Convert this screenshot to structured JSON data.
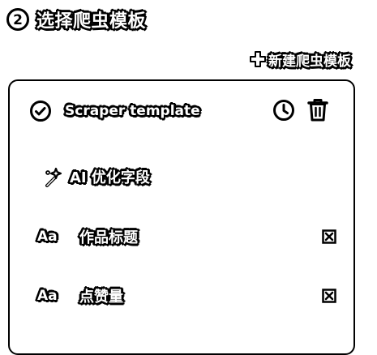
{
  "step": {
    "number": "2",
    "title": "选择爬虫模板"
  },
  "actions": {
    "new_template_label": "新建爬虫模板"
  },
  "template": {
    "name": "Scraper template",
    "selected": true
  },
  "ai_optimize": {
    "label": "AI 优化字段"
  },
  "fields": [
    {
      "type_icon": "Aa",
      "label": "作品标题"
    },
    {
      "type_icon": "Aa",
      "label": "点赞量"
    }
  ],
  "icons": {
    "step_badge": "circled-number-icon",
    "new": "plus-icon",
    "check": "check-circle-icon",
    "history": "clock-icon",
    "delete": "trash-icon",
    "ai": "sparkle-icon",
    "text_field": "text-type-icon",
    "remove": "close-box-icon"
  }
}
